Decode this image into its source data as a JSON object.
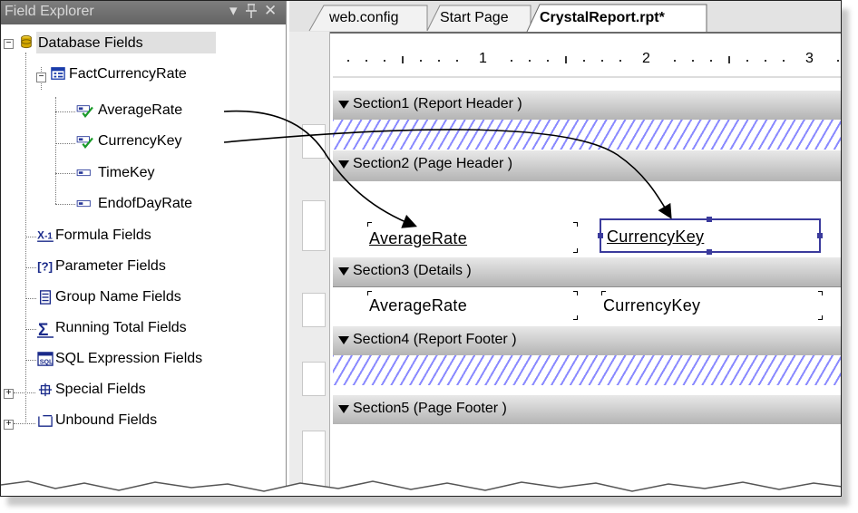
{
  "field_explorer": {
    "title": "Field Explorer",
    "controls": {
      "dropdown": "▾",
      "pin": "ꟸ",
      "close": "✕"
    },
    "database_fields": "Database Fields",
    "table": "FactCurrencyRate",
    "columns": [
      "AverageRate",
      "CurrencyKey",
      "TimeKey",
      "EndofDayRate"
    ],
    "categories": [
      "Formula Fields",
      "Parameter Fields",
      "Group Name Fields",
      "Running Total Fields",
      "SQL Expression Fields",
      "Special Fields",
      "Unbound Fields"
    ]
  },
  "tabs": [
    "web.config",
    "Start Page",
    "CrystalReport.rpt*"
  ],
  "ruler": {
    "labels": [
      "1",
      "2",
      "3"
    ]
  },
  "sections": [
    "Section1 (Report Header )",
    "Section2 (Page Header )",
    "Section3 (Details )",
    "Section4 (Report Footer )",
    "Section5 (Page Footer )"
  ],
  "page_header_fields": [
    "AverageRate",
    "CurrencyKey"
  ],
  "detail_fields": [
    "AverageRate",
    "CurrencyKey"
  ],
  "colors": {
    "check": "#1a9a2a",
    "selection": "#3a3a9c",
    "hatch": "#8a8aff"
  }
}
